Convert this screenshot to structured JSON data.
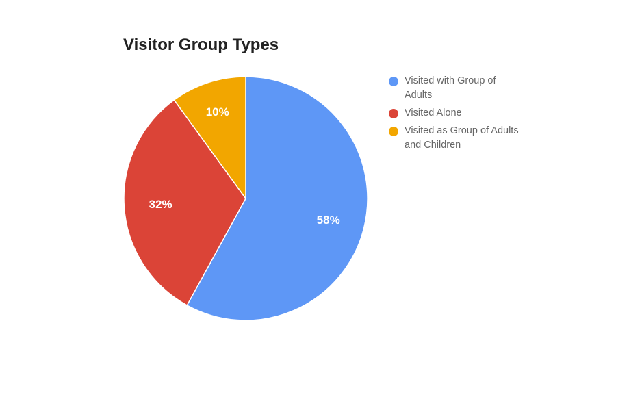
{
  "chart_data": {
    "type": "pie",
    "title": "Visitor Group Types",
    "legend_position": "right",
    "slices": [
      {
        "name": "Visited with Group of Adults",
        "value": 58,
        "label": "58%",
        "color": "#5E97F6"
      },
      {
        "name": "Visited Alone",
        "value": 32,
        "label": "32%",
        "color": "#DB4437"
      },
      {
        "name": "Visited as Group of Adults and Children",
        "value": 10,
        "label": "10%",
        "color": "#F2A600"
      }
    ]
  }
}
